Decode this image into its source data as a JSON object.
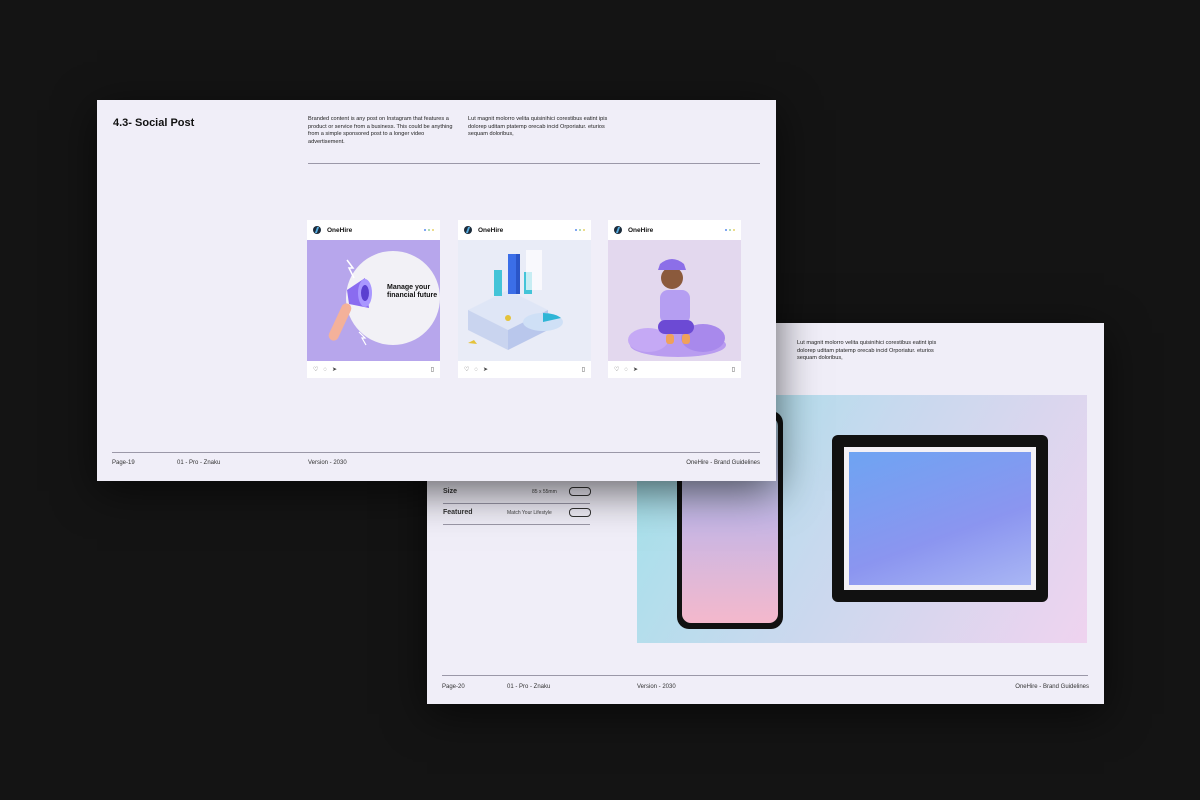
{
  "front": {
    "title": "4.3- Social Post",
    "paragraph_1": "Branded content is any post on Instagram that features a product or service from a business. This could be anything from a simple sponsored post to a longer video advertisement.",
    "paragraph_2": "Lut magnit molorro velita quisinihici corestibus eatint ipis dolorep uditam ptatemp orecab incid Orporiatur. eturios sequam doloribus,",
    "posts": [
      {
        "brand": "OneHire",
        "image_text": "Manage your financial future"
      },
      {
        "brand": "OneHire",
        "image_text": ""
      },
      {
        "brand": "OneHire",
        "image_text": ""
      }
    ],
    "footer": {
      "page": "Page-19",
      "series": "01 - Pro - Znaku",
      "version": "Version - 2030",
      "doc": "OneHire - Brand Guidelines"
    }
  },
  "back": {
    "paragraph": "Lut magnit molorro velita quisinihici corestibus eatint ipis dolorep uditam ptatemp orecab incid Orporiatur. eturios sequam doloribus,",
    "specs": [
      {
        "label": "Size",
        "value": "85 x 55mm"
      },
      {
        "label": "Featured",
        "value": "Match Your Lifestyle"
      }
    ],
    "footer": {
      "page": "Page-20",
      "series": "01 - Pro - Znaku",
      "version": "Version - 2030",
      "doc": "OneHire - Brand Guidelines"
    }
  },
  "icons": [
    "heart-icon",
    "comment-icon",
    "send-icon",
    "bookmark-icon",
    "megaphone-icon"
  ],
  "colors": {
    "background": "#141414",
    "slide": "#f0eef8",
    "accent": "#b7a6ec",
    "dot_blue": "#5b8dee",
    "dot_green": "#9ad39a",
    "dot_yellow": "#e8d36a"
  }
}
